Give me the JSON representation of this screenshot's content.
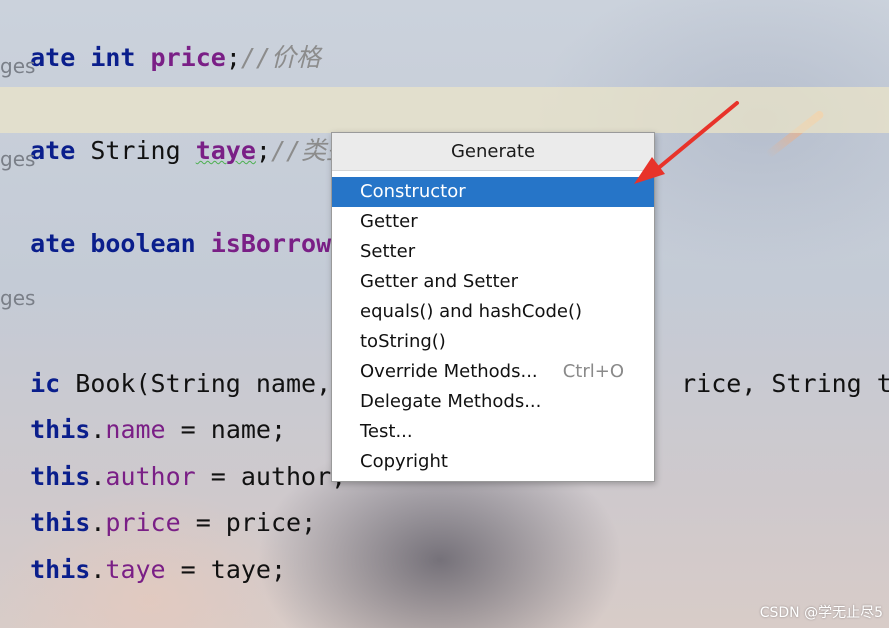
{
  "editor": {
    "line1": {
      "kw": "ate",
      "type": "int",
      "field": "price",
      "semi": ";",
      "comment": "//价格"
    },
    "hint1": "ges",
    "line2": {
      "kw": "ate",
      "type": "String",
      "field": "taye",
      "semi": ";",
      "comment": "//类型"
    },
    "hint2": "ges",
    "line3": {
      "kw": "ate",
      "type": "boolean",
      "field": "isBorrowed"
    },
    "hint3": "ges",
    "line4": {
      "kw": "ic",
      "text_a": " Book(String name, S",
      "text_b": "rice, String ta"
    },
    "assignments": [
      {
        "this": "this",
        "field": "name",
        "rest": " = name;"
      },
      {
        "this": "this",
        "field": "author",
        "rest": " = author;"
      },
      {
        "this": "this",
        "field": "price",
        "rest": " = price;"
      },
      {
        "this": "this",
        "field": "taye",
        "rest": " = taye;"
      }
    ]
  },
  "popup": {
    "title": "Generate",
    "items": [
      {
        "label": "Constructor",
        "shortcut": "",
        "selected": true
      },
      {
        "label": "Getter",
        "shortcut": ""
      },
      {
        "label": "Setter",
        "shortcut": ""
      },
      {
        "label": "Getter and Setter",
        "shortcut": ""
      },
      {
        "label": "equals() and hashCode()",
        "shortcut": ""
      },
      {
        "label": "toString()",
        "shortcut": ""
      },
      {
        "label": "Override Methods...",
        "shortcut": "Ctrl+O"
      },
      {
        "label": "Delegate Methods...",
        "shortcut": ""
      },
      {
        "label": "Test...",
        "shortcut": ""
      },
      {
        "label": "Copyright",
        "shortcut": ""
      }
    ]
  },
  "colors": {
    "selection": "#2675c8",
    "annotation_arrow": "#e8332a"
  },
  "icons": {
    "annotation": "red-arrow-icon"
  },
  "watermark": "CSDN @学无止尽5"
}
